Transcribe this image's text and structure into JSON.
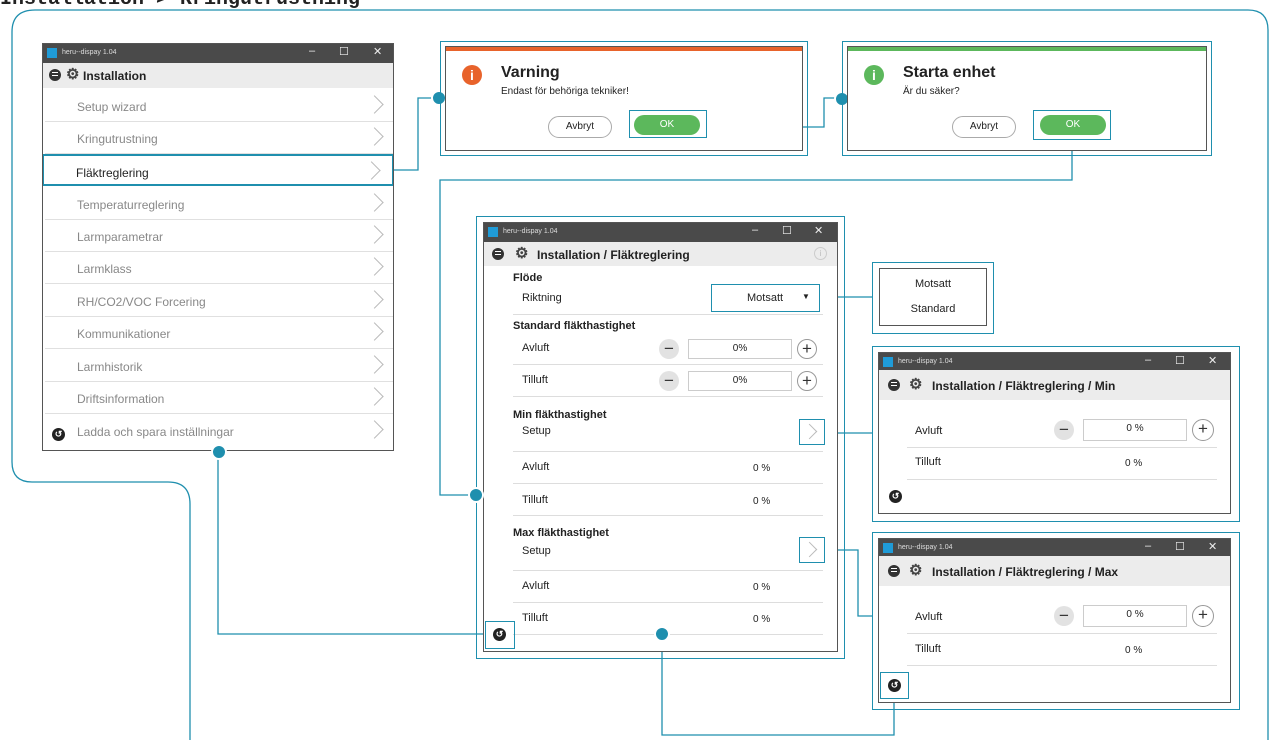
{
  "page_title": "Installation > Kringutrustning",
  "app_title": "heru--dispay 1.04",
  "window_controls": {
    "min": "–",
    "max": "☐",
    "close": "✕"
  },
  "main_window": {
    "title": "Installation",
    "items": [
      {
        "label": "Setup wizard"
      },
      {
        "label": "Kringutrustning"
      },
      {
        "label": "Fläktreglering"
      },
      {
        "label": "Temperaturreglering"
      },
      {
        "label": "Larmparametrar"
      },
      {
        "label": "Larmklass"
      },
      {
        "label": "RH/CO2/VOC Forcering"
      },
      {
        "label": "Kommunikationer"
      },
      {
        "label": "Larmhistorik"
      },
      {
        "label": "Driftsinformation"
      },
      {
        "label": "Ladda och spara inställningar"
      }
    ]
  },
  "warning_dialog": {
    "title": "Varning",
    "message": "Endast för behöriga tekniker!",
    "cancel": "Avbryt",
    "ok": "OK",
    "accent": "#e8632b"
  },
  "start_dialog": {
    "title": "Starta enhet",
    "message": "Är du säker?",
    "cancel": "Avbryt",
    "ok": "OK",
    "accent": "#5cb85c"
  },
  "fan_window": {
    "title": "Installation / Fläktreglering",
    "flow_section": "Flöde",
    "direction_label": "Riktning",
    "direction_value": "Motsatt",
    "standard_section": "Standard fläkthastighet",
    "std_exhaust_label": "Avluft",
    "std_exhaust_value": "0%",
    "std_supply_label": "Tilluft",
    "std_supply_value": "0%",
    "min_section": "Min fläkthastighet",
    "min_setup_label": "Setup",
    "min_exhaust_label": "Avluft",
    "min_exhaust_value": "0 %",
    "min_supply_label": "Tilluft",
    "min_supply_value": "0 %",
    "max_section": "Max fläkthastighet",
    "max_setup_label": "Setup",
    "max_exhaust_label": "Avluft",
    "max_exhaust_value": "0 %",
    "max_supply_label": "Tilluft",
    "max_supply_value": "0 %"
  },
  "direction_options": [
    "Motsatt",
    "Standard"
  ],
  "min_window": {
    "title": "Installation / Fläktreglering / Min",
    "exhaust_label": "Avluft",
    "exhaust_value": "0 %",
    "supply_label": "Tilluft",
    "supply_value": "0 %"
  },
  "max_window": {
    "title": "Installation / Fläktreglering / Max",
    "exhaust_label": "Avluft",
    "exhaust_value": "0 %",
    "supply_label": "Tilluft",
    "supply_value": "0 %"
  },
  "colors": {
    "connector": "#1f8fae",
    "titlebar": "#4a4a4a",
    "ok_green": "#5cb85c",
    "warning_orange": "#e8632b",
    "info_green": "#5cb85c"
  }
}
